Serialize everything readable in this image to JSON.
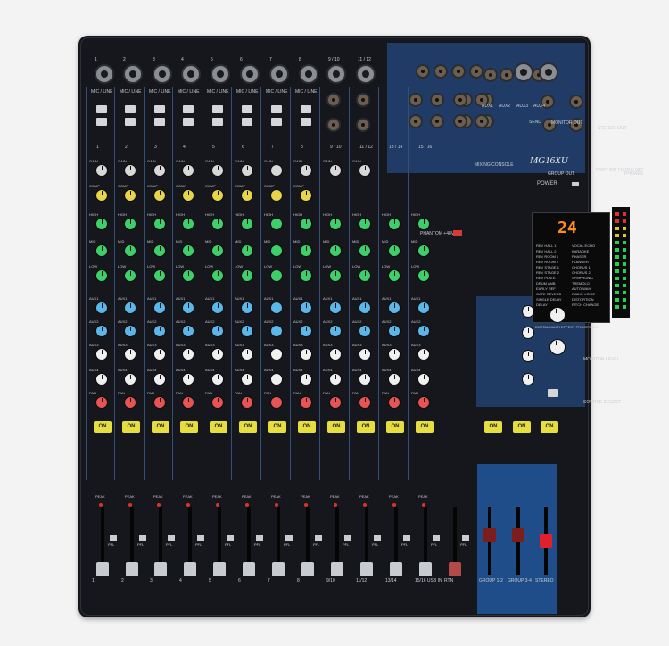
{
  "model": "MG16XU",
  "subtitle": "MIXING CONSOLE",
  "power_label": "POWER",
  "display_value": "24",
  "channel_numbers": [
    "1",
    "2",
    "3",
    "4",
    "5",
    "6",
    "7",
    "8",
    "9 / 10",
    "11 / 12",
    "13 / 14",
    "15 / 16"
  ],
  "input_label": "MIC / LINE",
  "send_labels": [
    "AUX1",
    "AUX2",
    "AUX3",
    "AUX4"
  ],
  "section_labels": {
    "send": "SEND",
    "monitor_out": "MONITOR OUT",
    "stereo_out": "STEREO OUT",
    "group_out": "GROUP OUT",
    "phones": "PHONES",
    "footsw": "FOOT SW FX ON / OFF",
    "phantom": "PHANTOM +48V",
    "monitor_level": "MONITOR LEVEL",
    "source_select": "SOURCE SELECT",
    "fx_name": "DIGITAL MULTI EFFECT PROCESSOR"
  },
  "knob_rows": [
    "GAIN",
    "COMP",
    "HIGH",
    "MID",
    "LOW",
    "AUX1",
    "AUX2",
    "AUX3",
    "AUX4",
    "PAN"
  ],
  "fx_list_left": [
    "REV HALL 1",
    "REV HALL 2",
    "REV ROOM 1",
    "REV ROOM 2",
    "REV STAGE 1",
    "REV STAGE 2",
    "REV PLATE",
    "DRUM AMB",
    "EARLY REF",
    "GATE REVERB",
    "SINGLE DELAY",
    "DELAY"
  ],
  "fx_list_right": [
    "VOCAL ECHO",
    "KARAOKE",
    "PHASER",
    "FLANGER",
    "CHORUS 1",
    "CHORUS 2",
    "SYMPHONIC",
    "TREMOLO",
    "AUTO WAH",
    "RADIO VOICE",
    "DISTORTION",
    "PITCH CHANGE"
  ],
  "on_label": "ON",
  "peak_label": "PEAK",
  "pfl_label": "PFL",
  "fader_labels": [
    "1",
    "2",
    "3",
    "4",
    "5",
    "6",
    "7",
    "8",
    "9/10",
    "11/12",
    "13/14",
    "15/16 USB IN",
    "RTN",
    "GROUP 1-2",
    "GROUP 3-4",
    "STEREO"
  ],
  "colors": {
    "body": "#15171c",
    "blue_panel": "#203c66",
    "gain": "#d8d8d8",
    "comp": "#e8d44a",
    "eq": "#3fcf6a",
    "aux12": "#5ab7e8",
    "aux34": "#f0f0f0",
    "pan": "#e85454",
    "on_button": "#e6dd40"
  }
}
